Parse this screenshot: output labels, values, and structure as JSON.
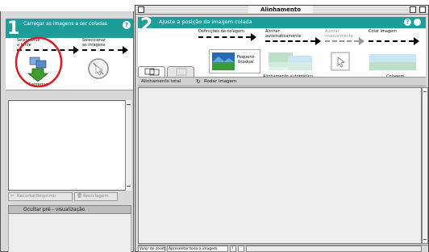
{
  "left_panel": {
    "step_number": "1",
    "title": "Carregar as imagens a ser coladas",
    "help_label": "?",
    "step1_label": "Seleccionar\na fonte",
    "step2_label": "Seleccionar\nas imagens",
    "load_button_label": "Carregar",
    "cut_print_label": "Recortar/Imprimir",
    "trash_label": "Reciclagem",
    "hide_preview_label": "Ocultar pré - visualização"
  },
  "right_window": {
    "window_title": "Alinhamento",
    "step_number": "2",
    "title": "Ajuste a posição da imagem colada",
    "steps": [
      {
        "label": "Definições da colagem"
      },
      {
        "label": "Alinhar\nautomaticamente"
      },
      {
        "label": "Ajustar\nmanualmente"
      },
      {
        "label": "Colar imagem"
      }
    ],
    "small_gradual_label": "Pequeno\nGradual",
    "auto_align_label": "Alinhamento automático",
    "collage_label": "Colagem",
    "toolbar": {
      "total_alignment": "Alinhamento total",
      "rotate_image": "Rodar imagem"
    },
    "status": {
      "zoom_label": "Valor de zoom",
      "show_all": "Apresentar toda a imagem",
      "page_field": "?"
    }
  },
  "colors": {
    "teal": "#1e9e9a",
    "highlight_circle": "#d42020"
  }
}
